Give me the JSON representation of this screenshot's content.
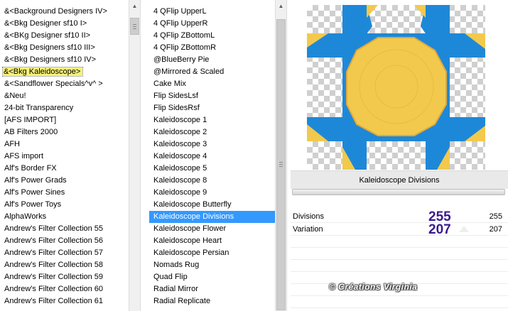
{
  "categories": [
    "&<Background Designers IV>",
    "&<Bkg Designer sf10 I>",
    "&<BKg Designer sf10 II>",
    "&<Bkg Designers sf10 III>",
    "&<Bkg Designers sf10 IV>",
    "&<Bkg Kaleidoscope>",
    "&<Sandflower Specials^v^ >",
    "&Neu!",
    "24-bit Transparency",
    "[AFS IMPORT]",
    "AB Filters 2000",
    "AFH",
    "AFS import",
    "Alf's Border FX",
    "Alf's Power Grads",
    "Alf's Power Sines",
    "Alf's Power Toys",
    "AlphaWorks",
    "Andrew's Filter Collection 55",
    "Andrew's Filter Collection 56",
    "Andrew's Filter Collection 57",
    "Andrew's Filter Collection 58",
    "Andrew's Filter Collection 59",
    "Andrew's Filter Collection 60",
    "Andrew's Filter Collection 61"
  ],
  "filters": [
    "4 QFlip UpperL",
    "4 QFlip UpperR",
    "4 QFlip ZBottomL",
    "4 QFlip ZBottomR",
    "@BlueBerry Pie",
    "@Mirrored & Scaled",
    "Cake Mix",
    "Flip SidesLsf",
    "Flip SidesRsf",
    "Kaleidoscope 1",
    "Kaleidoscope 2",
    "Kaleidoscope 3",
    "Kaleidoscope 4",
    "Kaleidoscope 5",
    "Kaleidoscope 8",
    "Kaleidoscope 9",
    "Kaleidoscope Butterfly",
    "Kaleidoscope Divisions",
    "Kaleidoscope Flower",
    "Kaleidoscope Heart",
    "Kaleidoscope Persian",
    "Nomads Rug",
    "Quad Flip",
    "Radial Mirror",
    "Radial Replicate"
  ],
  "selected_category_index": 5,
  "selected_filter_index": 17,
  "filter_title": "Kaleidoscope Divisions",
  "params": [
    {
      "name": "Divisions",
      "value": "255",
      "big": "255"
    },
    {
      "name": "Variation",
      "value": "207",
      "big": "207"
    }
  ],
  "watermark": "© Créations Virginia",
  "colors": {
    "selection": "#3399ff",
    "category_highlight": "#f6f17a",
    "preview_yellow": "#f2c94c",
    "preview_blue": "#1e88d8",
    "big_number": "#3b1a8c"
  },
  "icons": {
    "scroll_up": "▲",
    "scroll_down": "▼"
  }
}
